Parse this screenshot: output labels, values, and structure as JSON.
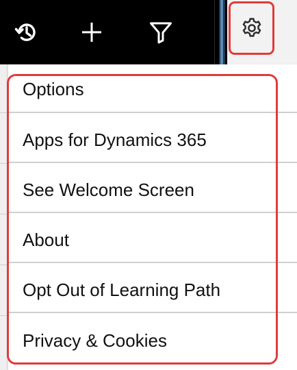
{
  "toolbar": {
    "history_icon": "history-icon",
    "new_icon": "plus-icon",
    "filter_icon": "filter-icon",
    "settings_icon": "gear-icon"
  },
  "menu": {
    "items": [
      {
        "label": "Options"
      },
      {
        "label": "Apps for Dynamics 365"
      },
      {
        "label": "See Welcome Screen"
      },
      {
        "label": "About"
      },
      {
        "label": "Opt Out of Learning Path"
      },
      {
        "label": "Privacy & Cookies"
      }
    ]
  },
  "colors": {
    "toolbar_bg": "#000000",
    "highlight": "#e23a3a",
    "menu_bg": "#ffffff",
    "separator": "#cfcfcf"
  }
}
